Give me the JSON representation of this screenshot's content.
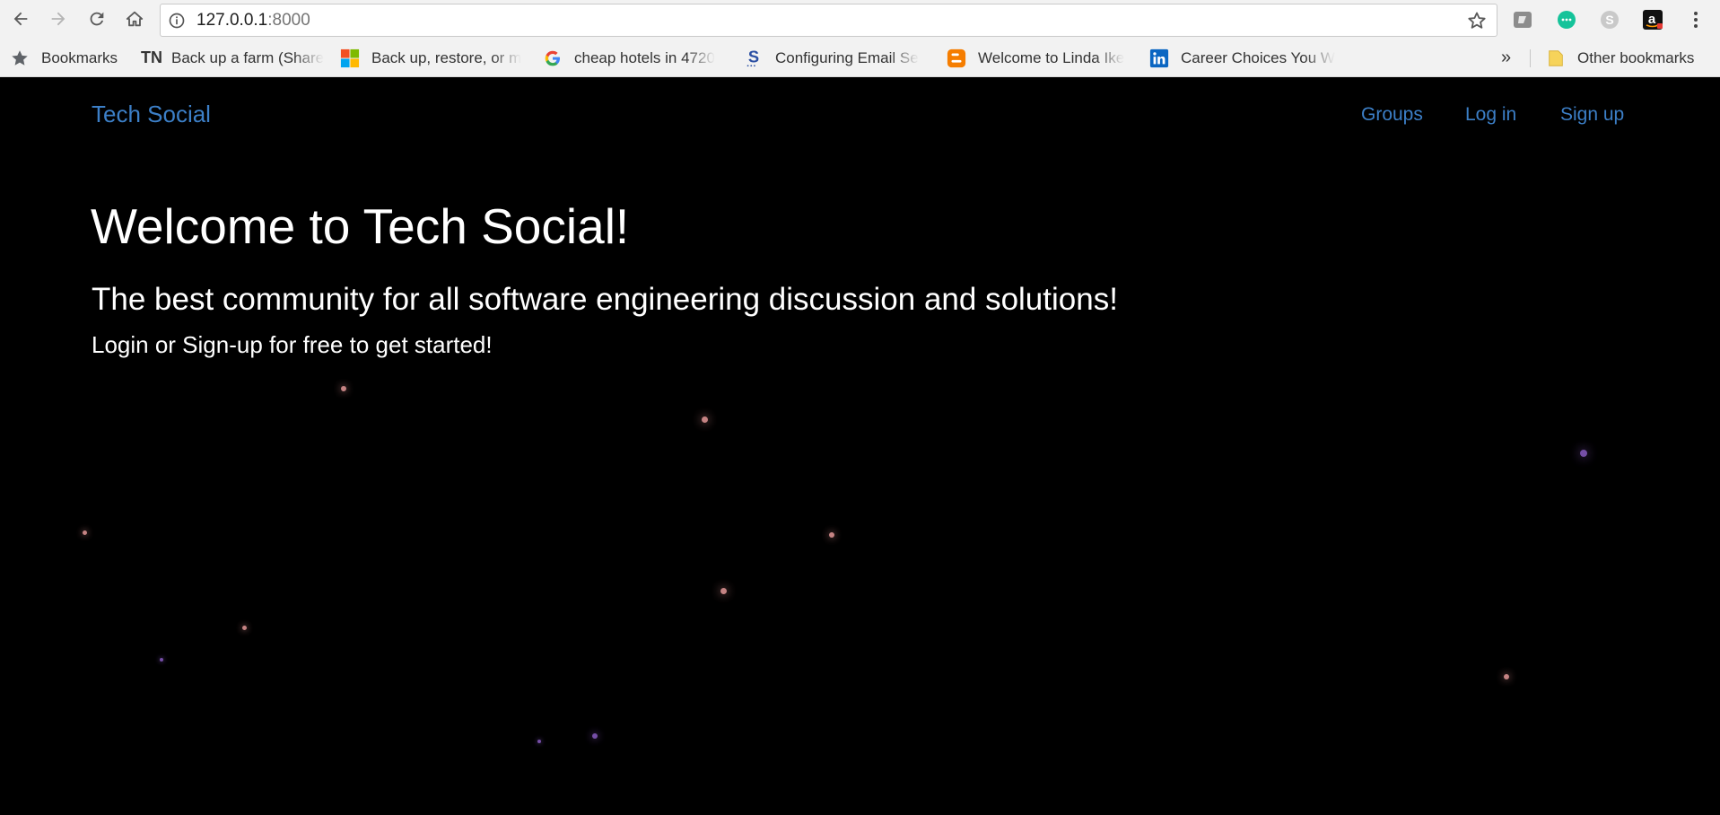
{
  "browser": {
    "url_host": "127.0.0.1",
    "url_port": ":8000",
    "bookmarks": [
      {
        "label": "Bookmarks",
        "icon": "star-icon"
      },
      {
        "label": "Back up a farm (Share",
        "icon": "tn-icon",
        "icon_text": "TN"
      },
      {
        "label": "Back up, restore, or m",
        "icon": "microsoft-icon"
      },
      {
        "label": "cheap hotels in 4720",
        "icon": "google-icon"
      },
      {
        "label": "Configuring Email Se",
        "icon": "s-icon"
      },
      {
        "label": "Welcome to Linda Ike",
        "icon": "blogger-icon"
      },
      {
        "label": "Career Choices You W",
        "icon": "linkedin-icon"
      }
    ],
    "overflow_label": "»",
    "other_bookmarks_label": "Other bookmarks"
  },
  "navbar": {
    "brand": "Tech Social",
    "links": [
      "Groups",
      "Log in",
      "Sign up"
    ],
    "link_color": "#3c7fc7"
  },
  "hero": {
    "title": "Welcome to Tech Social!",
    "subtitle": "The best community for all software engineering discussion and solutions!",
    "cta": "Login or Sign-up for free to get started!"
  },
  "colors": {
    "page_background": "#000000",
    "chrome_background": "#f2f2f2",
    "particle_pink": "#e89a9a",
    "particle_purple": "#8a5cc4"
  }
}
